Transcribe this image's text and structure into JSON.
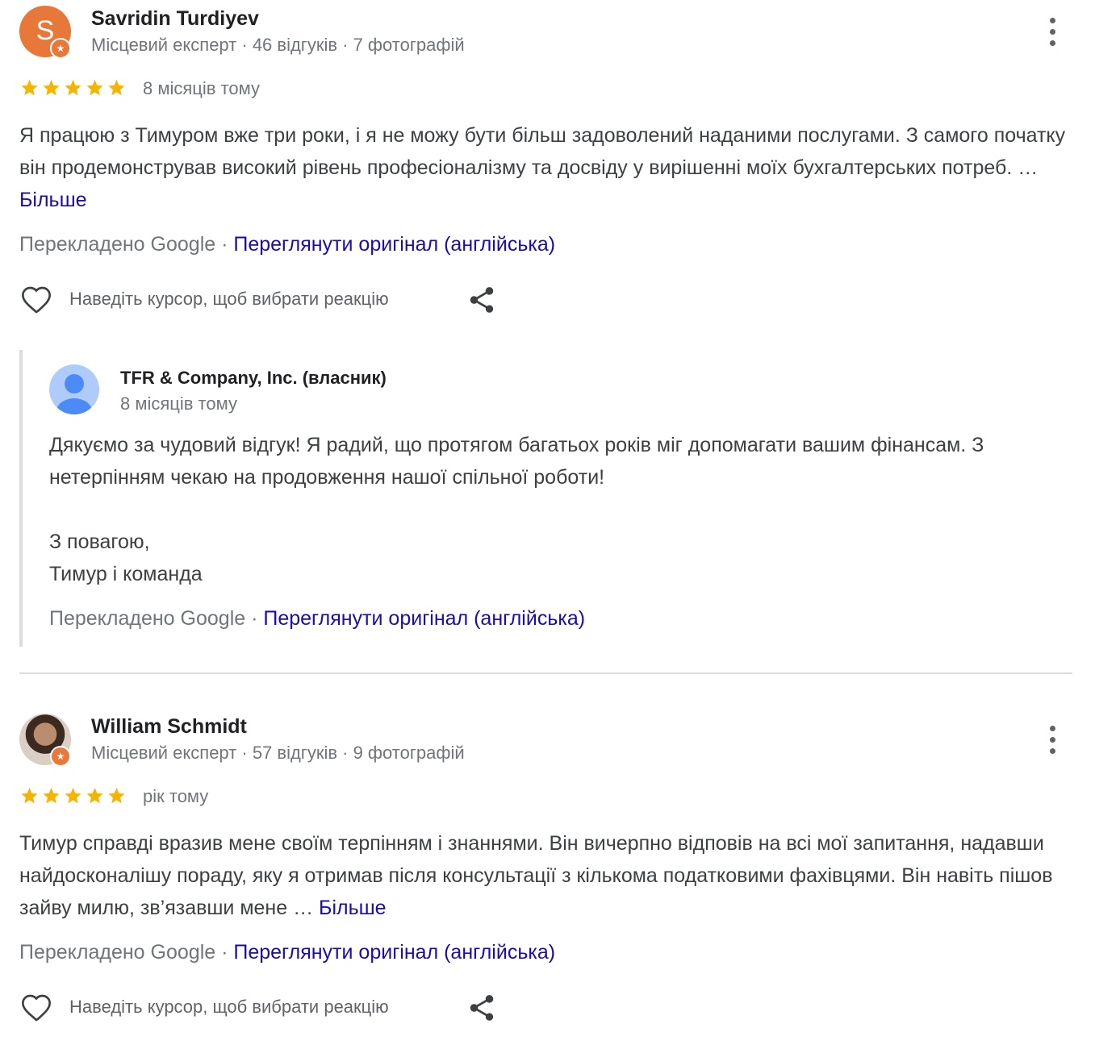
{
  "reviews": [
    {
      "author": "Savridin Turdiyev",
      "avatar_letter": "S",
      "meta": "Місцевий експерт · 46 відгуків · 7 фотографій",
      "rating": 5,
      "date": "8 місяців тому",
      "text": "Я працюю з Тимуром вже три роки, і я не можу бути більш задоволений наданими послугами. З самого початку він продемонстрував високий рівень професіоналізму та досвіду у вирішенні моїх бухгалтерських потреб. … ",
      "more_label": "Більше",
      "translated_label": "Перекладено Google · ",
      "original_link": "Переглянути оригінал (англійська)",
      "reaction_hint": "Наведіть курсор, щоб вибрати реакцію"
    },
    {
      "author": "William Schmidt",
      "meta": "Місцевий експерт · 57 відгуків · 9 фотографій",
      "rating": 5,
      "date": "рік тому",
      "text": "Тимур справді вразив мене своїм терпінням і знаннями. Він вичерпно відповів на всі мої запитання, надавши найдосконалішу пораду, яку я отримав після консультації з кількома податковими фахівцями. Він навіть пішов зайву милю, зв’язавши мене … ",
      "more_label": "Більше",
      "translated_label": "Перекладено Google · ",
      "original_link": "Переглянути оригінал (англійська)",
      "reaction_hint": "Наведіть курсор, щоб вибрати реакцію"
    }
  ],
  "owner_reply": {
    "name": "TFR & Company, Inc. (власник)",
    "date": "8 місяців тому",
    "line1": "Дякуємо за чудовий відгук! Я радий, що протягом багатьох років міг допомагати вашим фінансам. З нетерпінням чекаю на продовження нашої спільної роботи!",
    "line2": "З повагою,",
    "line3": "Тимур і команда",
    "translated_label": "Перекладено Google · ",
    "original_link": "Переглянути оригінал (англійська)"
  },
  "colors": {
    "star": "#f4b400",
    "link": "#1a0dab",
    "avatar_orange": "#e8773a",
    "owner_avatar": "#aecbfa"
  },
  "icons": [
    "star-icon",
    "heart-icon",
    "share-icon",
    "more-vert-icon",
    "local-guide-badge-icon",
    "person-icon"
  ]
}
